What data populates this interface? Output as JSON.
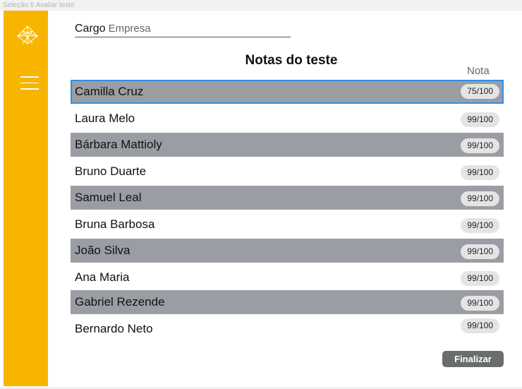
{
  "frame_label": "Seleção 5 Avaliar teste",
  "header": {
    "cargo_label": "Cargo",
    "company": "Empresa"
  },
  "title": "Notas do teste",
  "score_column_label": "Nota",
  "candidates": [
    {
      "name": "Camilla  Cruz",
      "score": "75/100"
    },
    {
      "name": "Laura Melo",
      "score": "99/100"
    },
    {
      "name": "Bárbara Mattioly",
      "score": "99/100"
    },
    {
      "name": "Bruno Duarte",
      "score": "99/100"
    },
    {
      "name": "Samuel Leal",
      "score": "99/100"
    },
    {
      "name": "Bruna Barbosa",
      "score": "99/100"
    },
    {
      "name": "João Silva",
      "score": "99/100"
    },
    {
      "name": "Ana Maria",
      "score": "99/100"
    },
    {
      "name": "Gabriel Rezende",
      "score": "99/100"
    },
    {
      "name": "Bernardo Neto",
      "score": "99/100"
    }
  ],
  "finalize_label": "Finalizar",
  "colors": {
    "sidebar": "#f7b500",
    "row_shaded": "#9a9ea4",
    "selection": "#2f8fe8",
    "button": "#6a6e6a"
  },
  "icons": {
    "logo": "geometric-logo-icon",
    "menu": "hamburger-menu-icon"
  }
}
